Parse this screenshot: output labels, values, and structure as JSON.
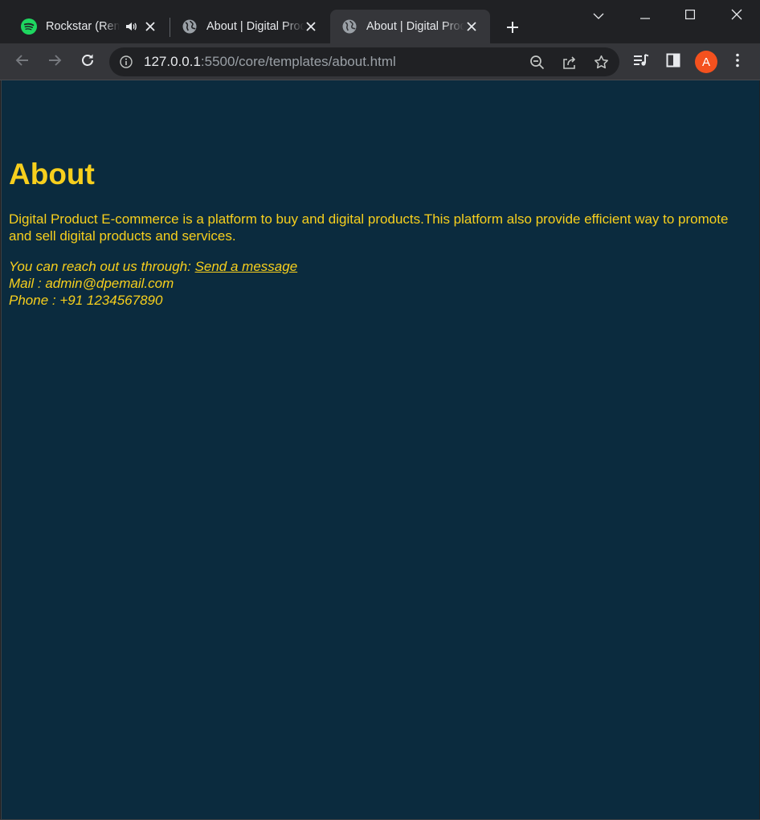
{
  "browser": {
    "tabs": [
      {
        "title": "Rockstar (Remix)",
        "favicon": "spotify-icon",
        "audio": true,
        "active": false
      },
      {
        "title": "About | Digital Product",
        "favicon": "globe-icon",
        "audio": false,
        "active": false
      },
      {
        "title": "About | Digital Product",
        "favicon": "globe-icon",
        "audio": false,
        "active": true
      }
    ],
    "address": {
      "host": "127.0.0.1",
      "path": ":5500/core/templates/about.html"
    },
    "profile_initial": "A",
    "colors": {
      "tabstrip": "#202124",
      "toolbar": "#35363a",
      "profile": "#f4511e",
      "spotify": "#1ed760"
    }
  },
  "page": {
    "title": "About",
    "description": "Digital Product E-commerce is a platform to buy and digital products.This platform also provide efficient way to promote and sell digital products and services.",
    "contact": {
      "reach_prefix": "You can reach out us through: ",
      "reach_link": "Send a message",
      "mail": "Mail : admin@dpemail.com",
      "phone": "Phone : +91 1234567890"
    },
    "colors": {
      "background": "#0b2b3e",
      "text": "#f7cf1d"
    }
  }
}
